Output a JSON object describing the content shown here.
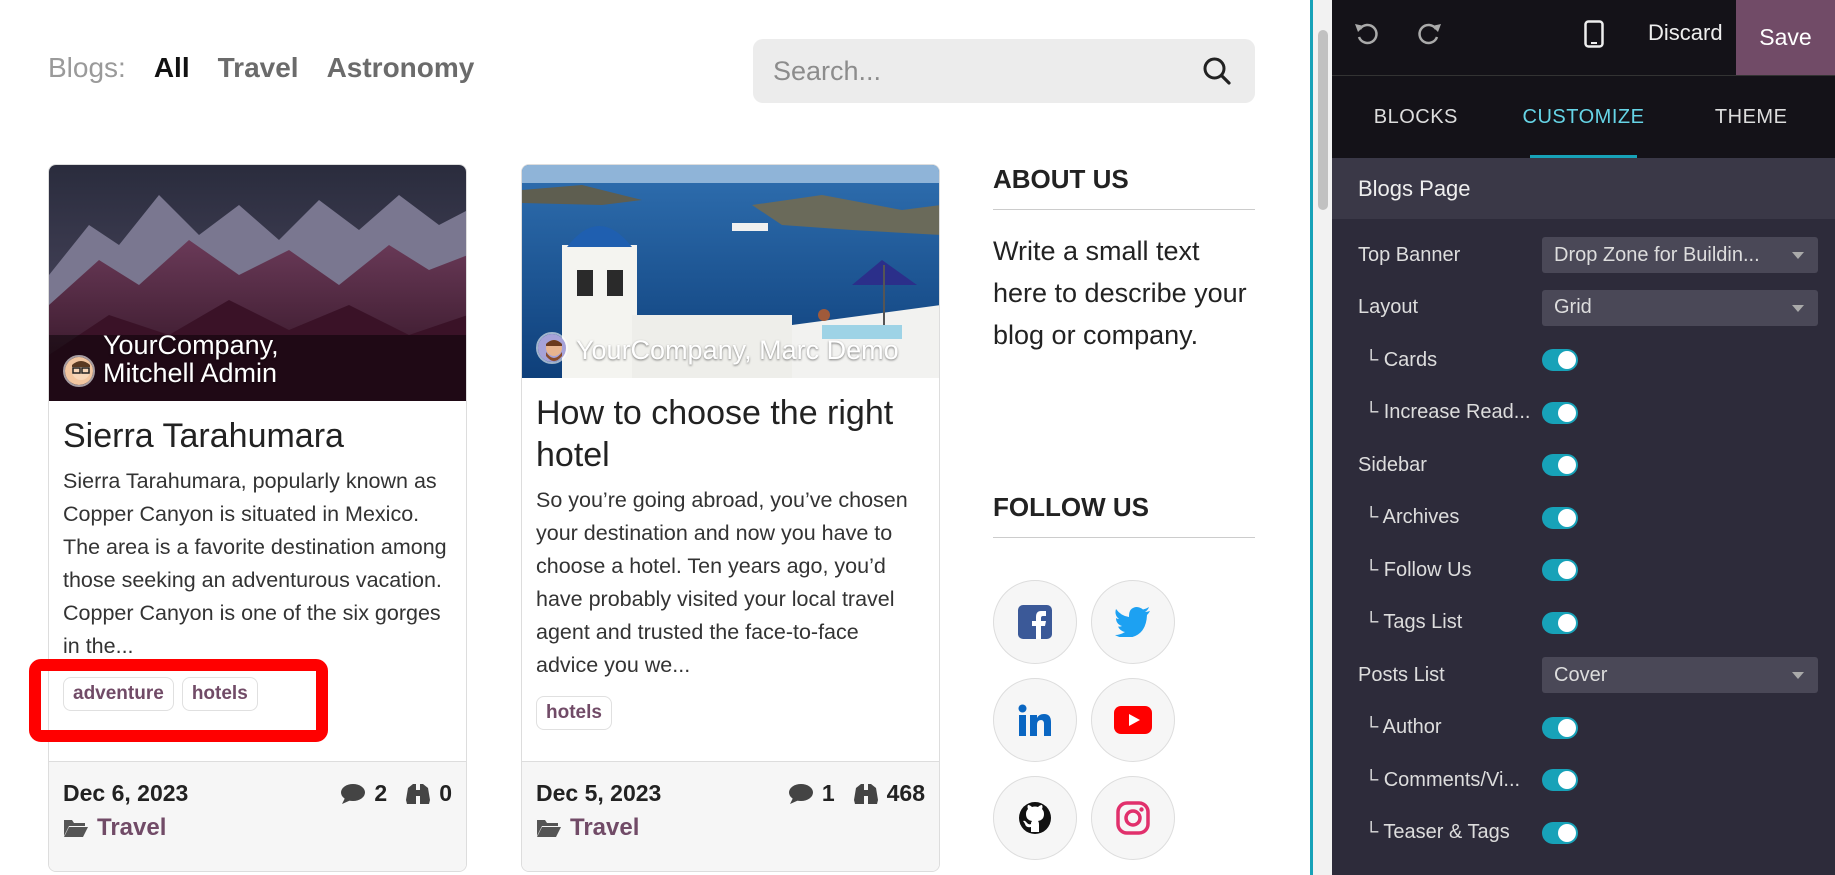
{
  "blogs_nav": {
    "label": "Blogs:",
    "items": [
      "All",
      "Travel",
      "Astronomy"
    ]
  },
  "search": {
    "placeholder": "Search..."
  },
  "posts": [
    {
      "author": "YourCompany, Mitchell Admin",
      "title": "Sierra Tarahumara",
      "teaser": "Sierra Tarahumara, popularly known as Copper Canyon is situated in Mexico. The area is a favorite destination among those seeking an adventurous vacation. Copper Canyon is one of the six gorges in the...",
      "tags": [
        "adventure",
        "hotels"
      ],
      "date": "Dec 6, 2023",
      "comments": "2",
      "views": "0",
      "category": "Travel"
    },
    {
      "author": "YourCompany, Marc Demo",
      "title": "How to choose the right hotel",
      "teaser": "So you’re going abroad, you’ve chosen your destination and now you have to choose a hotel. Ten years ago, you’d have probably visited your local travel agent and trusted the face-to-face advice you we...",
      "tags": [
        "hotels"
      ],
      "date": "Dec 5, 2023",
      "comments": "1",
      "views": "468",
      "category": "Travel"
    }
  ],
  "sidebar": {
    "about_title": "ABOUT US",
    "about_text": "Write a small text here to describe your blog or company.",
    "follow_title": "FOLLOW US",
    "socials": [
      "facebook-icon",
      "twitter-icon",
      "linkedin-icon",
      "youtube-icon",
      "github-icon",
      "instagram-icon"
    ]
  },
  "editor": {
    "discard": "Discard",
    "save": "Save",
    "tabs": [
      "BLOCKS",
      "CUSTOMIZE",
      "THEME"
    ],
    "active_tab": "CUSTOMIZE",
    "section": "Blogs Page",
    "options": [
      {
        "label": "Top Banner",
        "type": "select",
        "value": "Drop Zone for Buildin..."
      },
      {
        "label": "Layout",
        "type": "select",
        "value": "Grid"
      },
      {
        "label": "└ Cards",
        "type": "toggle",
        "on": true
      },
      {
        "label": "└ Increase Read...",
        "type": "toggle",
        "on": true
      },
      {
        "label": "Sidebar",
        "type": "toggle",
        "on": true
      },
      {
        "label": "└ Archives",
        "type": "toggle",
        "on": true
      },
      {
        "label": "└ Follow Us",
        "type": "toggle",
        "on": true
      },
      {
        "label": "└ Tags List",
        "type": "toggle",
        "on": true
      },
      {
        "label": "Posts List",
        "type": "select",
        "value": "Cover"
      },
      {
        "label": "└ Author",
        "type": "toggle",
        "on": true
      },
      {
        "label": "└ Comments/Vi...",
        "type": "toggle",
        "on": true
      },
      {
        "label": "└ Teaser & Tags",
        "type": "toggle",
        "on": true
      }
    ]
  },
  "colors": {
    "brand": "#714b67",
    "accent": "#17a2b8",
    "panel": "#2d2b3a",
    "highlight": "#ff0000"
  }
}
